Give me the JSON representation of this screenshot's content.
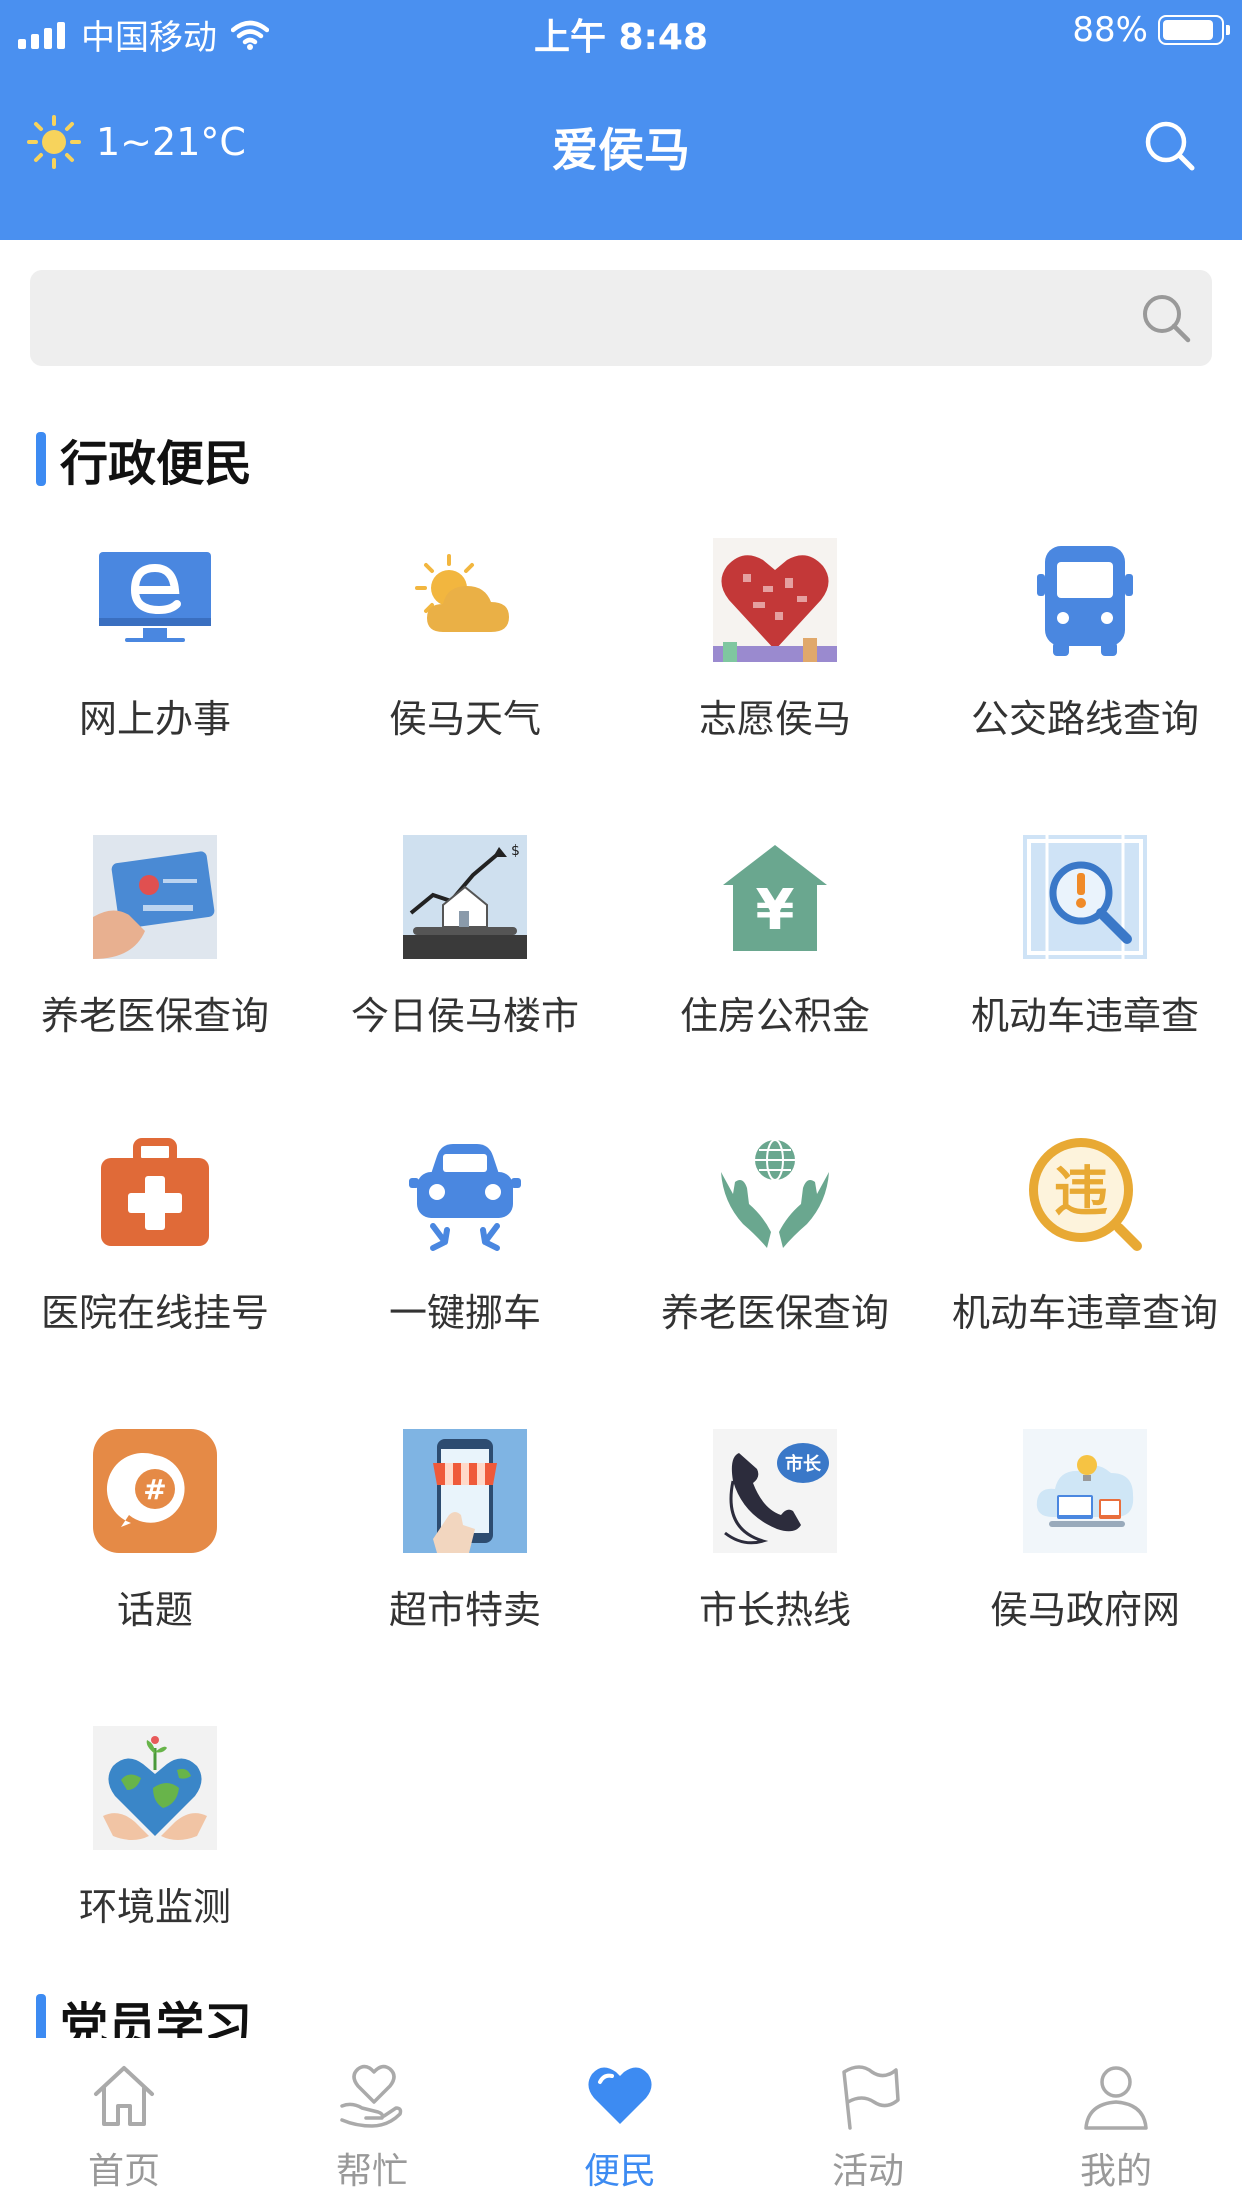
{
  "status_bar": {
    "carrier": "中国移动",
    "time": "上午 8:48",
    "battery": "88%"
  },
  "header": {
    "weather": "1~21°C",
    "title": "爱侯马"
  },
  "search": {
    "placeholder": ""
  },
  "sections": {
    "admin": "行政便民",
    "party": "党员学习"
  },
  "services": [
    {
      "label": "网上办事",
      "icon": "e-government-monitor-icon"
    },
    {
      "label": "侯马天气",
      "icon": "weather-sun-cloud-icon"
    },
    {
      "label": "志愿侯马",
      "icon": "volunteer-heart-icon"
    },
    {
      "label": "公交路线查询",
      "icon": "bus-icon"
    },
    {
      "label": "养老医保查询",
      "icon": "insurance-card-icon"
    },
    {
      "label": "今日侯马楼市",
      "icon": "housing-market-icon"
    },
    {
      "label": "住房公积金",
      "icon": "housing-fund-icon"
    },
    {
      "label": "机动车违章查",
      "icon": "vehicle-violation-search-icon"
    },
    {
      "label": "医院在线挂号",
      "icon": "medical-kit-icon"
    },
    {
      "label": "一键挪车",
      "icon": "move-car-icon"
    },
    {
      "label": "养老医保查询",
      "icon": "globe-hands-icon"
    },
    {
      "label": "机动车违章查询",
      "icon": "violation-badge-icon"
    },
    {
      "label": "话题",
      "icon": "topic-hashtag-icon"
    },
    {
      "label": "超市特卖",
      "icon": "supermarket-icon"
    },
    {
      "label": "市长热线",
      "icon": "mayor-hotline-icon",
      "badge": "市长"
    },
    {
      "label": "侯马政府网",
      "icon": "government-website-icon"
    },
    {
      "label": "环境监测",
      "icon": "environment-earth-icon"
    }
  ],
  "tabs": [
    {
      "label": "首页",
      "icon": "home-icon"
    },
    {
      "label": "帮忙",
      "icon": "help-heart-hand-icon"
    },
    {
      "label": "便民",
      "icon": "heart-icon"
    },
    {
      "label": "活动",
      "icon": "flag-icon"
    },
    {
      "label": "我的",
      "icon": "user-icon"
    }
  ],
  "colors": {
    "brand_blue": "#4a90f0",
    "active_tab": "#3d8bf2",
    "inactive_tab": "#999999"
  }
}
